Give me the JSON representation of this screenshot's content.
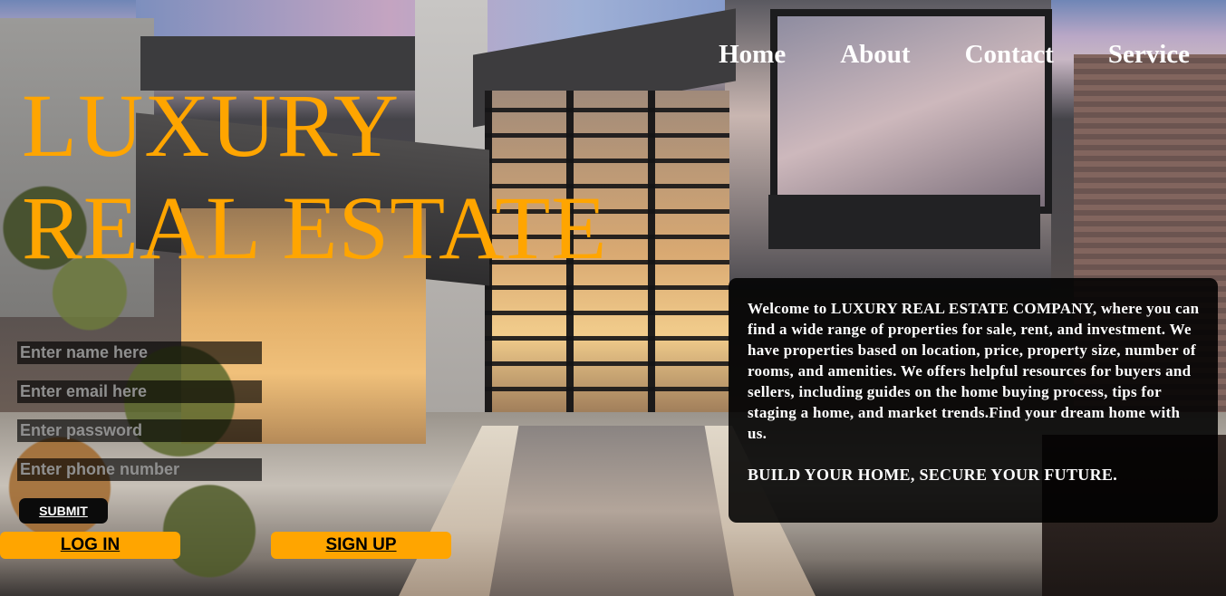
{
  "nav": {
    "items": [
      {
        "label": "Home"
      },
      {
        "label": "About"
      },
      {
        "label": "Contact"
      },
      {
        "label": "Service"
      }
    ]
  },
  "hero": {
    "title_line1": "LUXURY",
    "title_line2": "REAL ESTATE"
  },
  "form": {
    "name_placeholder": "Enter name here",
    "email_placeholder": "Enter email here",
    "password_placeholder": "Enter password",
    "phone_placeholder": "Enter phone number",
    "submit_label": "SUBMIT",
    "login_label": "LOG IN",
    "signup_label": "SIGN UP"
  },
  "info": {
    "description": "Welcome to LUXURY REAL ESTATE COMPANY, where you can find a wide range of properties for sale, rent, and investment. We have properties based on location, price, property size, number of rooms, and amenities. We offers helpful resources for buyers and sellers, including guides on the home buying process, tips for staging a home, and market trends.Find your dream home with us.",
    "slogan": "BUILD YOUR HOME, SECURE YOUR FUTURE."
  },
  "colors": {
    "accent": "#ffa500",
    "panel_bg": "#000000",
    "nav_text": "#ffffff"
  }
}
